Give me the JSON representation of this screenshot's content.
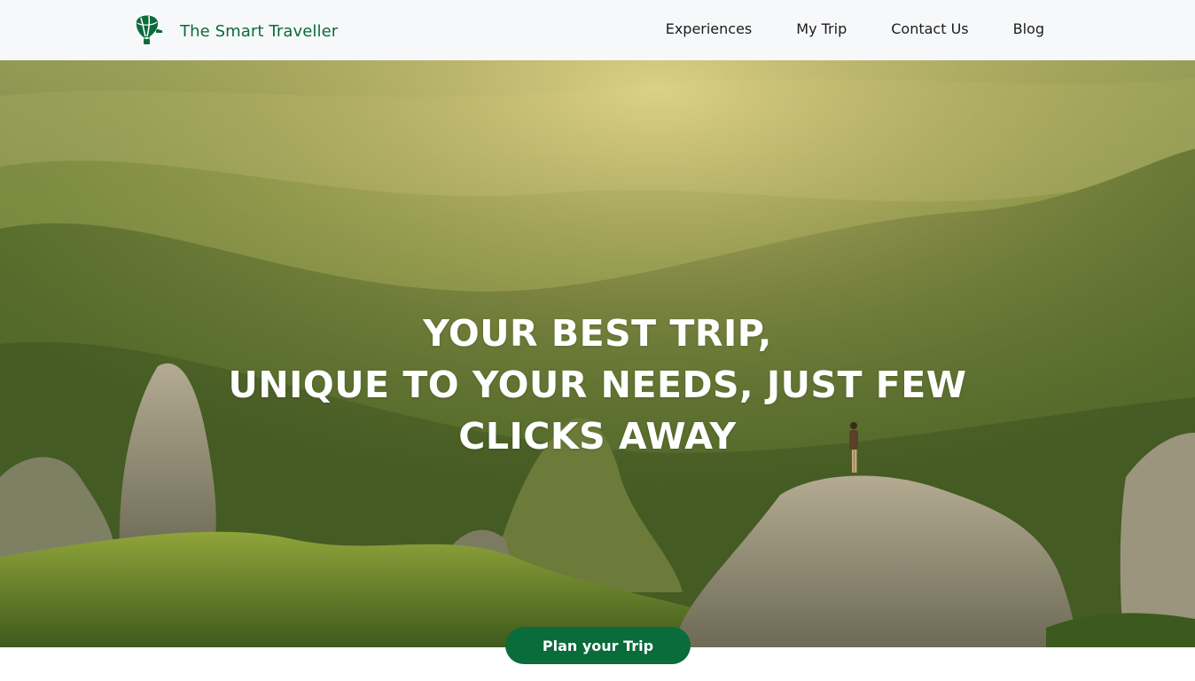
{
  "brand": {
    "name": "The Smart Traveller",
    "logo_icon": "hot-air-balloon-icon",
    "color": "#0a6b3b"
  },
  "nav": {
    "items": [
      "Experiences",
      "My Trip",
      "Contact Us",
      "Blog"
    ]
  },
  "hero": {
    "headline_lines": [
      "YOUR BEST TRIP,",
      "UNIQUE TO YOUR NEEDS, JUST FEW",
      "CLICKS AWAY"
    ],
    "cta_label": "Plan your Trip"
  }
}
